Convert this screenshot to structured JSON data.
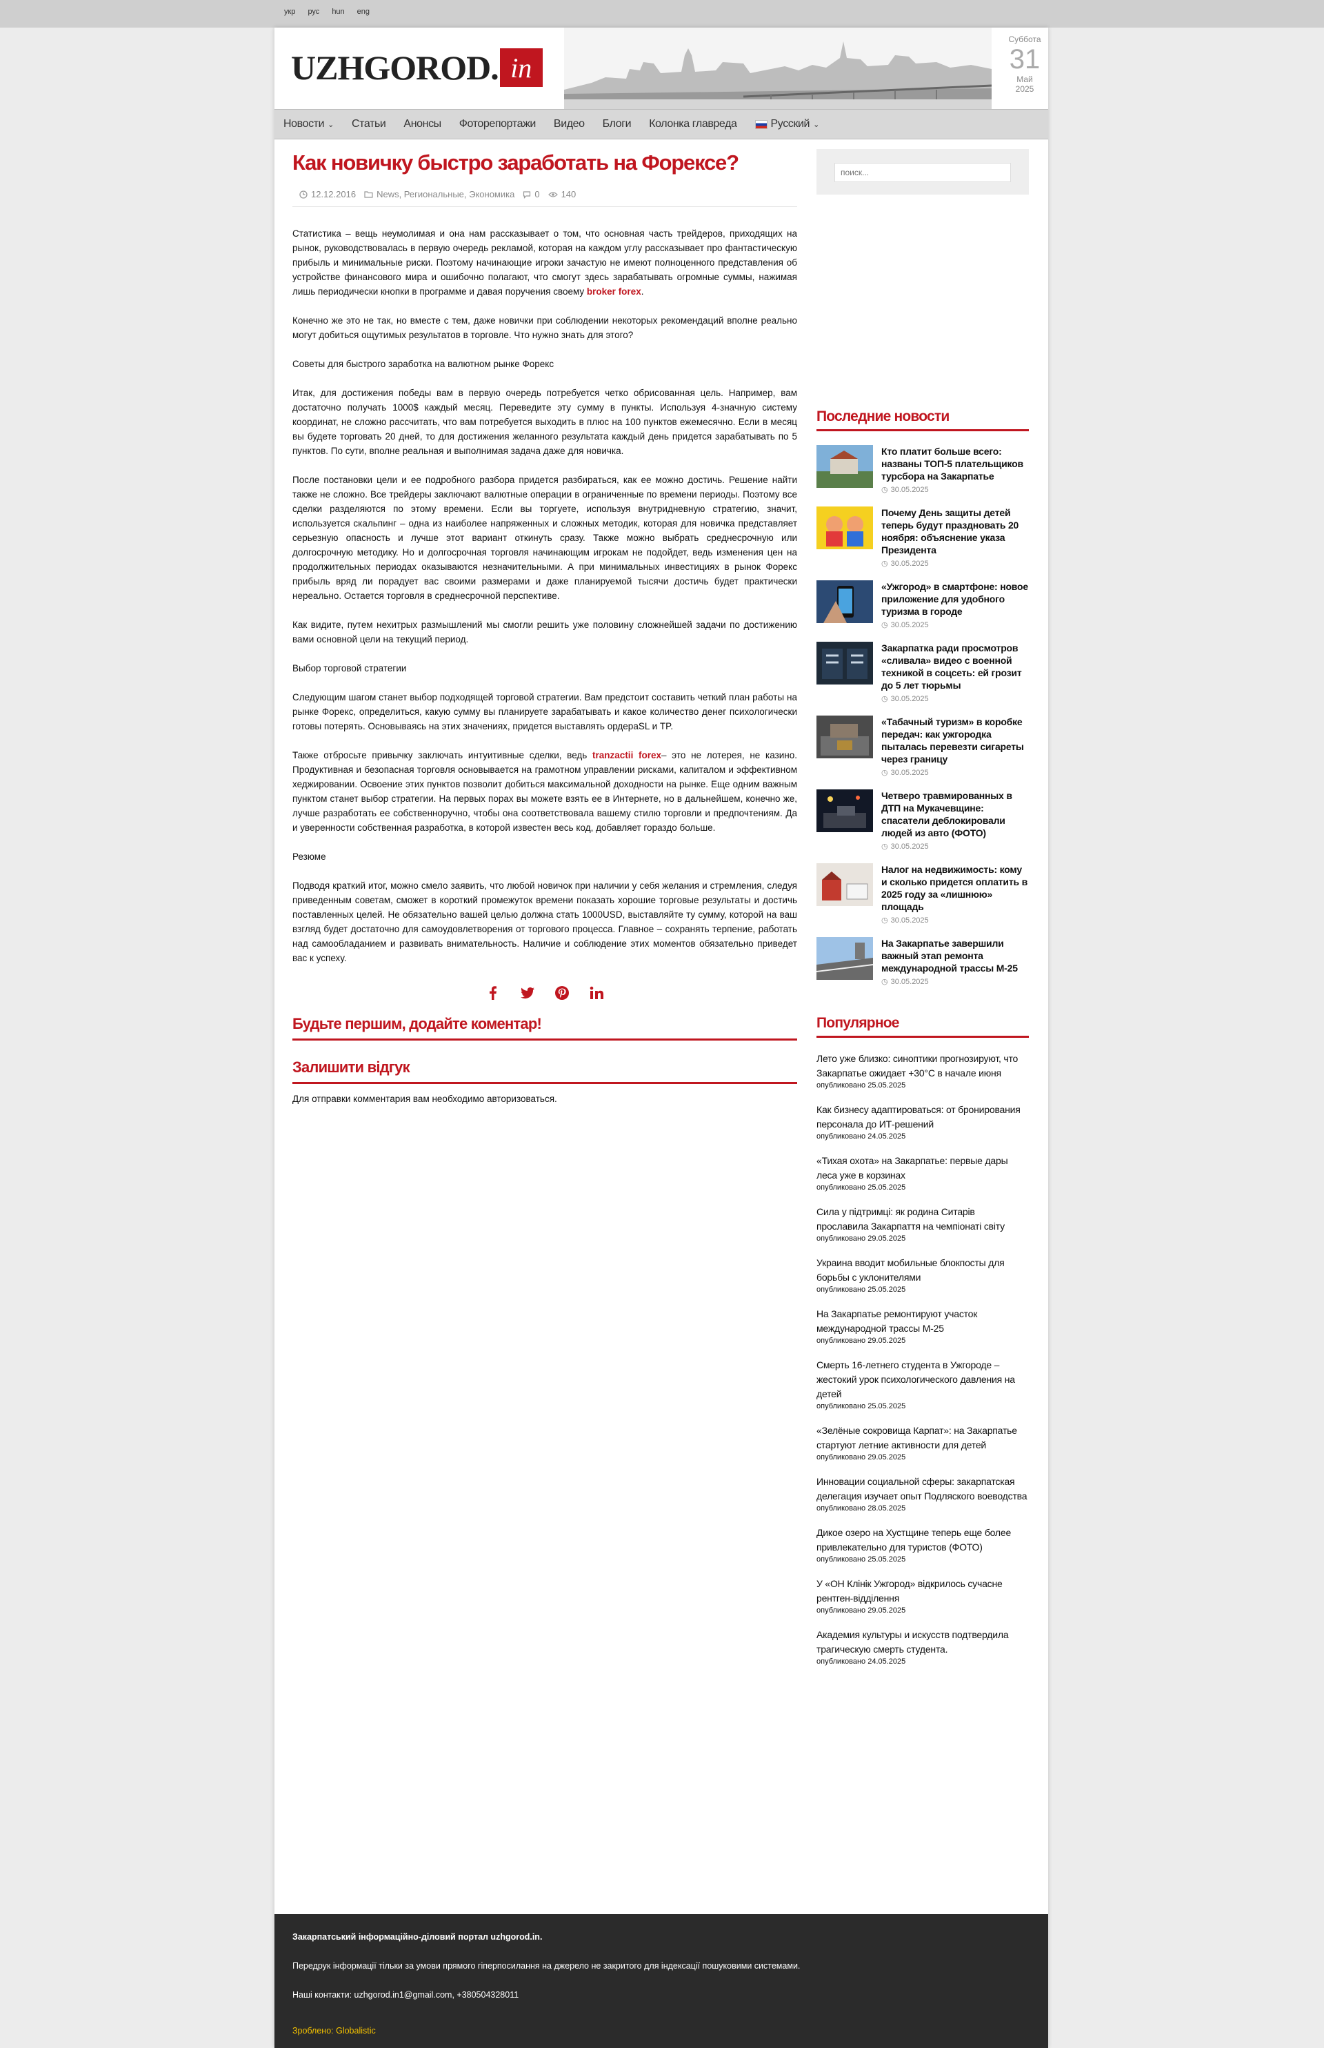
{
  "topbar": {
    "languages": [
      "укр",
      "рус",
      "hun",
      "eng"
    ]
  },
  "header": {
    "logo_text": "UZHGOROD.",
    "logo_badge": "in",
    "date": {
      "weekday": "Суббота",
      "day": "31",
      "month": "Май",
      "year": "2025"
    }
  },
  "nav": {
    "items": [
      "Новости",
      "Статьи",
      "Анонсы",
      "Фоторепортажи",
      "Видео",
      "Блоги",
      "Колонка главреда"
    ],
    "language": "Русский"
  },
  "article": {
    "title": "Как новичку быстро заработать на Форексе?",
    "date": "12.12.2016",
    "categories": "News, Региональные, Экономика",
    "comments": "0",
    "views": "140",
    "p1_text": "Статистика – вещь неумолимая и она нам рассказывает о том, что основная часть трейдеров, приходящих на рынок, руководствовалась в первую очередь рекламой, которая на каждом углу рассказывает про фантастическую прибыль и минимальные риски. Поэтому начинающие игроки зачастую не имеют полноценного представления об устройстве финансового мира и ошибочно полагают, что смогут здесь зарабатывать огромные суммы, нажимая лишь периодически кнопки в программе и давая поручения своему ",
    "p1_link": "broker forex",
    "p2": "Конечно же это не так, но вместе с тем, даже новички при соблюдении некоторых рекомендаций вполне реально могут добиться ощутимых результатов в торговле. Что нужно знать для этого?",
    "p3": "Советы для быстрого заработка на валютном рынке Форекс",
    "p4": "Итак, для достижения победы вам в первую очередь потребуется четко обрисованная цель. Например, вам достаточно получать 1000$ каждый месяц. Переведите эту сумму в пункты. Используя 4-значную систему координат, не сложно рассчитать, что вам потребуется выходить в плюс на 100 пунктов ежемесячно. Если в месяц вы будете торговать 20 дней, то для достижения желанного результата каждый день придется зарабатывать по 5 пунктов. По сути, вполне реальная и выполнимая задача даже для новичка.",
    "p5": "После постановки цели и ее подробного разбора придется разбираться, как ее можно достичь. Решение найти также не сложно. Все трейдеры заключают валютные операции в ограниченные по времени периоды. Поэтому все сделки разделяются по этому времени. Если вы торгуете, используя внутридневную стратегию, значит, используется скальпинг – одна из наиболее напряженных и сложных методик, которая для новичка представляет серьезную опасность и лучше этот вариант откинуть сразу. Также можно выбрать среднесрочную или долгосрочную методику. Но и долгосрочная торговля начинающим игрокам не подойдет, ведь изменения цен на продолжительных периодах оказываются незначительными. А при минимальных инвестициях в рынок Форекс прибыль вряд ли порадует вас своими размерами и даже планируемой тысячи достичь будет практически нереально. Остается торговля в среднесрочной перспективе.",
    "p6": "Как видите, путем нехитрых размышлений мы смогли решить уже половину сложнейшей задачи по достижению вами основной цели на текущий период.",
    "p7": "Выбор торговой стратегии",
    "p8": "Следующим шагом станет выбор подходящей торговой стратегии. Вам предстоит составить четкий план работы на рынке Форекс, определиться, какую сумму вы планируете зарабатывать и какое количество денег психологически готовы потерять. Основываясь на этих значениях, придется выставлять ордераSL и TP.",
    "p9_before": "Также отбросьте привычку заключать интуитивные сделки, ведь ",
    "p9_link": "tranzactii forex",
    "p9_after": "– это не лотерея, не казино. Продуктивная и безопасная торговля основывается на грамотном управлении рисками, капиталом и эффективном хеджировании. Освоение этих пунктов позволит добиться максимальной доходности на рынке. Еще одним важным пунктом станет выбор стратегии. На первых порах вы можете взять ее в Интернете, но в дальнейшем, конечно же, лучше разработать ее собственноручно, чтобы она соответствовала вашему стилю торговли и предпочтениям. Да и уверенности собственная разработка, в которой известен весь код, добавляет гораздо больше.",
    "p10": "Резюме",
    "p11": " Подводя краткий итог, можно смело заявить, что любой новичок при наличии у себя желания и стремления, следуя приведенным советам, сможет в короткий промежуток времени показать хорошие торговые результаты и достичь поставленных целей. Не обязательно вашей целью должна стать 1000USD, выставляйте ту сумму, которой на ваш взгляд будет достаточно для самоудовлетворения от торгового процесса. Главное – сохранять терпение, работать над самообладанием и развивать внимательность. Наличие и соблюдение этих моментов обязательно приведет вас к успеху."
  },
  "comments": {
    "first_heading": "Будьте першим, додайте коментар!",
    "leave_heading": "Залишити відгук",
    "login_note": "Для отправки комментария вам необходимо авторизоваться."
  },
  "sidebar": {
    "search_placeholder": "поиск...",
    "latest_heading": "Последние новости",
    "latest": [
      {
        "title": "Кто платит больше всего: названы ТОП-5 плательщиков турсбора на Закарпатье",
        "date": "30.05.2025"
      },
      {
        "title": "Почему День защиты детей теперь будут праздновать 20 ноября: объяснение указа Президента",
        "date": "30.05.2025"
      },
      {
        "title": "«Ужгород» в смартфоне: новое приложение для удобного туризма в городе",
        "date": "30.05.2025"
      },
      {
        "title": "Закарпатка ради просмотров «сливала» видео с военной техникой в соцсеть: ей грозит до 5 лет тюрьмы",
        "date": "30.05.2025"
      },
      {
        "title": "«Табачный туризм» в коробке передач: как ужгородка пыталась перевезти сигареты через границу",
        "date": "30.05.2025"
      },
      {
        "title": "Четверо травмированных в ДТП на Мукачевщине: спасатели деблокировали людей из авто (ФОТО)",
        "date": "30.05.2025"
      },
      {
        "title": "Налог на недвижимость: кому и сколько придется оплатить в 2025 году за «лишнюю» площадь",
        "date": "30.05.2025"
      },
      {
        "title": "На Закарпатье завершили важный этап ремонта международной трассы М-25",
        "date": "30.05.2025"
      }
    ],
    "popular_heading": "Популярное",
    "popular": [
      {
        "title": "Лето уже близко: синоптики прогнозируют, что Закарпатье ожидает +30°C в начале июня",
        "date": "опубликовано 25.05.2025"
      },
      {
        "title": "Как бизнесу адаптироваться: от бронирования персонала до ИТ-решений",
        "date": "опубликовано 24.05.2025"
      },
      {
        "title": "«Тихая охота» на Закарпатье: первые дары леса уже в корзинах",
        "date": "опубликовано 25.05.2025"
      },
      {
        "title": "Сила у підтримці: як родина Ситарів прославила Закарпаття на чемпіонаті світу",
        "date": "опубликовано 29.05.2025"
      },
      {
        "title": "Украина вводит мобильные блокпосты для борьбы с уклонителями",
        "date": "опубликовано 25.05.2025"
      },
      {
        "title": "На Закарпатье ремонтируют участок международной трассы М-25",
        "date": "опубликовано 29.05.2025"
      },
      {
        "title": "Смерть 16-летнего студента в Ужгороде – жестокий урок психологического давления на детей",
        "date": "опубликовано 25.05.2025"
      },
      {
        "title": "«Зелёные сокровища Карпат»: на Закарпатье стартуют летние активности для детей",
        "date": "опубликовано 29.05.2025"
      },
      {
        "title": "Инновации социальной сферы: закарпатская делегация изучает опыт Подляского воеводства",
        "date": "опубликовано 28.05.2025"
      },
      {
        "title": "Дикое озеро на Хустщине теперь еще более привлекательно для туристов (ФОТО)",
        "date": "опубликовано 25.05.2025"
      },
      {
        "title": "У «ОН Клінік Ужгород» відкрилось сучасне рентген-відділення",
        "date": "опубликовано 29.05.2025"
      },
      {
        "title": "Академия культуры и искусств подтвердила трагическую смерть студента.",
        "date": "опубликовано 24.05.2025"
      }
    ]
  },
  "footer": {
    "line1": "Закарпатський інформаційно-діловий портал uzhgorod.in.",
    "line2": "Передрук інформації тільки за умови прямого гіперпосилання на джерело не закритого для індексації пошуковими системами.",
    "line3": "Наші контакти: uzhgorod.in1@gmail.com, +380504328011",
    "made_by": "Зроблено: Globalistic"
  },
  "colors": {
    "accent": "#c0161f",
    "footer_bg": "#2b2b2b",
    "footer_credit": "#f2c000"
  }
}
